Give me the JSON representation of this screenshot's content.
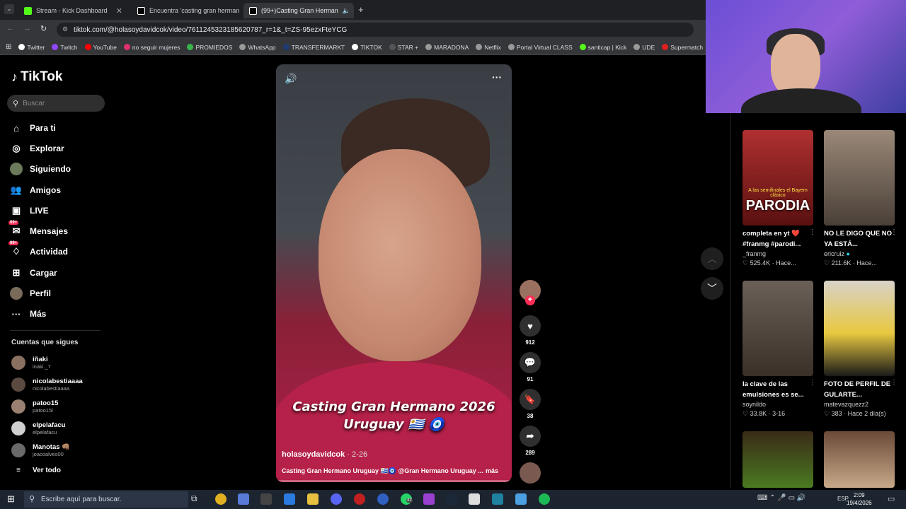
{
  "browser": {
    "tabs": [
      {
        "label": "Stream - Kick Dashboard",
        "color": "#53fc18"
      },
      {
        "label": "Encuentra 'casting gran herman",
        "color": "#ffffff"
      },
      {
        "label": "(99+)Casting Gran Herman",
        "color": "#ffffff"
      }
    ],
    "url": "tiktok.com/@holasoydavidcok/video/7611245323185620787_r=1&_t=ZS-95ezxFteYCG",
    "bookmarks": [
      "Twitter",
      "Twitch",
      "YouTube",
      "no seguir mujeres",
      "PROMIEDOS",
      "WhatsApp",
      "TRANSFERMARKT",
      "TIKTOK",
      "STAR +",
      "MARADONA",
      "Netflix",
      "Portal Virtual CLASS",
      "santicap | Kick",
      "UDE",
      "Supermatch"
    ]
  },
  "sidebar": {
    "logo": "TikTok",
    "search_placeholder": "Buscar",
    "nav": [
      {
        "label": "Para ti",
        "icon": "home-icon"
      },
      {
        "label": "Explorar",
        "icon": "compass-icon"
      },
      {
        "label": "Siguiendo",
        "icon": "avatar-icon"
      },
      {
        "label": "Amigos",
        "icon": "friends-icon"
      },
      {
        "label": "LIVE",
        "icon": "live-icon"
      },
      {
        "label": "Mensajes",
        "icon": "message-icon",
        "badge": "99+"
      },
      {
        "label": "Actividad",
        "icon": "activity-icon",
        "badge": "99+"
      },
      {
        "label": "Cargar",
        "icon": "upload-icon"
      },
      {
        "label": "Perfil",
        "icon": "profile-icon"
      },
      {
        "label": "Más",
        "icon": "more-icon"
      }
    ],
    "following_title": "Cuentas que sigues",
    "following": [
      {
        "name": "iñaki",
        "handle": "inaki._7"
      },
      {
        "name": "nicolabestiaaaa",
        "handle": "nicolabestiaaaa"
      },
      {
        "name": "patoo15",
        "handle": "patoo15l"
      },
      {
        "name": "elpelafacu",
        "handle": "elpelafacu"
      },
      {
        "name": "Manotas 👊🏽",
        "handle": "joacoalves00"
      }
    ],
    "see_all": "Ver todo"
  },
  "video": {
    "title_line1": "Casting Gran Hermano 2026",
    "title_line2": "Uruguay 🇺🇾 🧿",
    "author": "holasoydavidcok",
    "date": " · 2-26",
    "caption": "Casting Gran Hermano Uruguay 🇺🇾🧿 @Gran Hermano Uruguay ...",
    "more": "más",
    "likes": "912",
    "comments": "91",
    "saves": "38",
    "shares": "289"
  },
  "recommended": [
    {
      "title": "completa en yt ❤️ #franmg #parodi...",
      "author": "_franmg",
      "stats": "♡ 525.4K · Hace...",
      "overlay": "PARODIA",
      "overlay_small": "A las semifinales el Bayern clásico",
      "color": "#9a2a2a"
    },
    {
      "title": "NO LE DIGO QUE NO YA ESTÁ...",
      "author": "ericruiz",
      "stats": "♡ 211.6K · Hace...",
      "overlay": "",
      "overlay_small": "",
      "color": "#7a6a60"
    },
    {
      "title": "la clave de las emulsiones es se...",
      "author": "soynildo",
      "stats": "♡ 33.8K · 3-16",
      "overlay": "",
      "overlay_small": "",
      "color": "#5a5048"
    },
    {
      "title": "FOTO DE PERFIL DE GULARTE...",
      "author": "matevazquezz2",
      "stats": "♡ 383 · Hace 2 día(s)",
      "overlay": "",
      "overlay_small": "",
      "color": "#d8c060"
    },
    {
      "title": "",
      "author": "",
      "stats": "",
      "overlay": "",
      "overlay_small": "",
      "color": "#3a5a20"
    },
    {
      "title": "",
      "author": "",
      "stats": "",
      "overlay": "",
      "overlay_small": "",
      "color": "#6a4a38"
    }
  ],
  "taskbar": {
    "search_placeholder": "Escribe aquí para buscar.",
    "lang": "ESP",
    "time": "2:09",
    "date": "19/4/2026",
    "whatsapp_badge": "42"
  }
}
